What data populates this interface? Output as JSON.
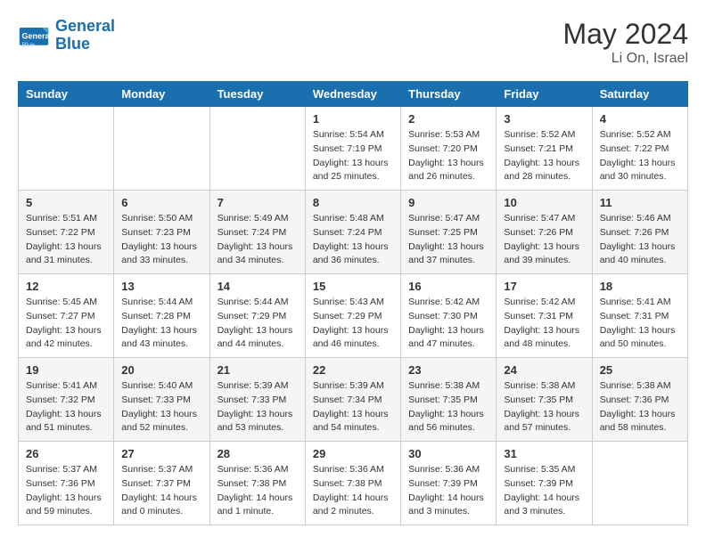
{
  "header": {
    "logo_text_general": "General",
    "logo_text_blue": "Blue",
    "month_year": "May 2024",
    "location": "Li On, Israel"
  },
  "weekdays": [
    "Sunday",
    "Monday",
    "Tuesday",
    "Wednesday",
    "Thursday",
    "Friday",
    "Saturday"
  ],
  "weeks": [
    [
      {
        "day": "",
        "info": ""
      },
      {
        "day": "",
        "info": ""
      },
      {
        "day": "",
        "info": ""
      },
      {
        "day": "1",
        "info": "Sunrise: 5:54 AM\nSunset: 7:19 PM\nDaylight: 13 hours\nand 25 minutes."
      },
      {
        "day": "2",
        "info": "Sunrise: 5:53 AM\nSunset: 7:20 PM\nDaylight: 13 hours\nand 26 minutes."
      },
      {
        "day": "3",
        "info": "Sunrise: 5:52 AM\nSunset: 7:21 PM\nDaylight: 13 hours\nand 28 minutes."
      },
      {
        "day": "4",
        "info": "Sunrise: 5:52 AM\nSunset: 7:22 PM\nDaylight: 13 hours\nand 30 minutes."
      }
    ],
    [
      {
        "day": "5",
        "info": "Sunrise: 5:51 AM\nSunset: 7:22 PM\nDaylight: 13 hours\nand 31 minutes."
      },
      {
        "day": "6",
        "info": "Sunrise: 5:50 AM\nSunset: 7:23 PM\nDaylight: 13 hours\nand 33 minutes."
      },
      {
        "day": "7",
        "info": "Sunrise: 5:49 AM\nSunset: 7:24 PM\nDaylight: 13 hours\nand 34 minutes."
      },
      {
        "day": "8",
        "info": "Sunrise: 5:48 AM\nSunset: 7:24 PM\nDaylight: 13 hours\nand 36 minutes."
      },
      {
        "day": "9",
        "info": "Sunrise: 5:47 AM\nSunset: 7:25 PM\nDaylight: 13 hours\nand 37 minutes."
      },
      {
        "day": "10",
        "info": "Sunrise: 5:47 AM\nSunset: 7:26 PM\nDaylight: 13 hours\nand 39 minutes."
      },
      {
        "day": "11",
        "info": "Sunrise: 5:46 AM\nSunset: 7:26 PM\nDaylight: 13 hours\nand 40 minutes."
      }
    ],
    [
      {
        "day": "12",
        "info": "Sunrise: 5:45 AM\nSunset: 7:27 PM\nDaylight: 13 hours\nand 42 minutes."
      },
      {
        "day": "13",
        "info": "Sunrise: 5:44 AM\nSunset: 7:28 PM\nDaylight: 13 hours\nand 43 minutes."
      },
      {
        "day": "14",
        "info": "Sunrise: 5:44 AM\nSunset: 7:29 PM\nDaylight: 13 hours\nand 44 minutes."
      },
      {
        "day": "15",
        "info": "Sunrise: 5:43 AM\nSunset: 7:29 PM\nDaylight: 13 hours\nand 46 minutes."
      },
      {
        "day": "16",
        "info": "Sunrise: 5:42 AM\nSunset: 7:30 PM\nDaylight: 13 hours\nand 47 minutes."
      },
      {
        "day": "17",
        "info": "Sunrise: 5:42 AM\nSunset: 7:31 PM\nDaylight: 13 hours\nand 48 minutes."
      },
      {
        "day": "18",
        "info": "Sunrise: 5:41 AM\nSunset: 7:31 PM\nDaylight: 13 hours\nand 50 minutes."
      }
    ],
    [
      {
        "day": "19",
        "info": "Sunrise: 5:41 AM\nSunset: 7:32 PM\nDaylight: 13 hours\nand 51 minutes."
      },
      {
        "day": "20",
        "info": "Sunrise: 5:40 AM\nSunset: 7:33 PM\nDaylight: 13 hours\nand 52 minutes."
      },
      {
        "day": "21",
        "info": "Sunrise: 5:39 AM\nSunset: 7:33 PM\nDaylight: 13 hours\nand 53 minutes."
      },
      {
        "day": "22",
        "info": "Sunrise: 5:39 AM\nSunset: 7:34 PM\nDaylight: 13 hours\nand 54 minutes."
      },
      {
        "day": "23",
        "info": "Sunrise: 5:38 AM\nSunset: 7:35 PM\nDaylight: 13 hours\nand 56 minutes."
      },
      {
        "day": "24",
        "info": "Sunrise: 5:38 AM\nSunset: 7:35 PM\nDaylight: 13 hours\nand 57 minutes."
      },
      {
        "day": "25",
        "info": "Sunrise: 5:38 AM\nSunset: 7:36 PM\nDaylight: 13 hours\nand 58 minutes."
      }
    ],
    [
      {
        "day": "26",
        "info": "Sunrise: 5:37 AM\nSunset: 7:36 PM\nDaylight: 13 hours\nand 59 minutes."
      },
      {
        "day": "27",
        "info": "Sunrise: 5:37 AM\nSunset: 7:37 PM\nDaylight: 14 hours\nand 0 minutes."
      },
      {
        "day": "28",
        "info": "Sunrise: 5:36 AM\nSunset: 7:38 PM\nDaylight: 14 hours\nand 1 minute."
      },
      {
        "day": "29",
        "info": "Sunrise: 5:36 AM\nSunset: 7:38 PM\nDaylight: 14 hours\nand 2 minutes."
      },
      {
        "day": "30",
        "info": "Sunrise: 5:36 AM\nSunset: 7:39 PM\nDaylight: 14 hours\nand 3 minutes."
      },
      {
        "day": "31",
        "info": "Sunrise: 5:35 AM\nSunset: 7:39 PM\nDaylight: 14 hours\nand 3 minutes."
      },
      {
        "day": "",
        "info": ""
      }
    ]
  ]
}
